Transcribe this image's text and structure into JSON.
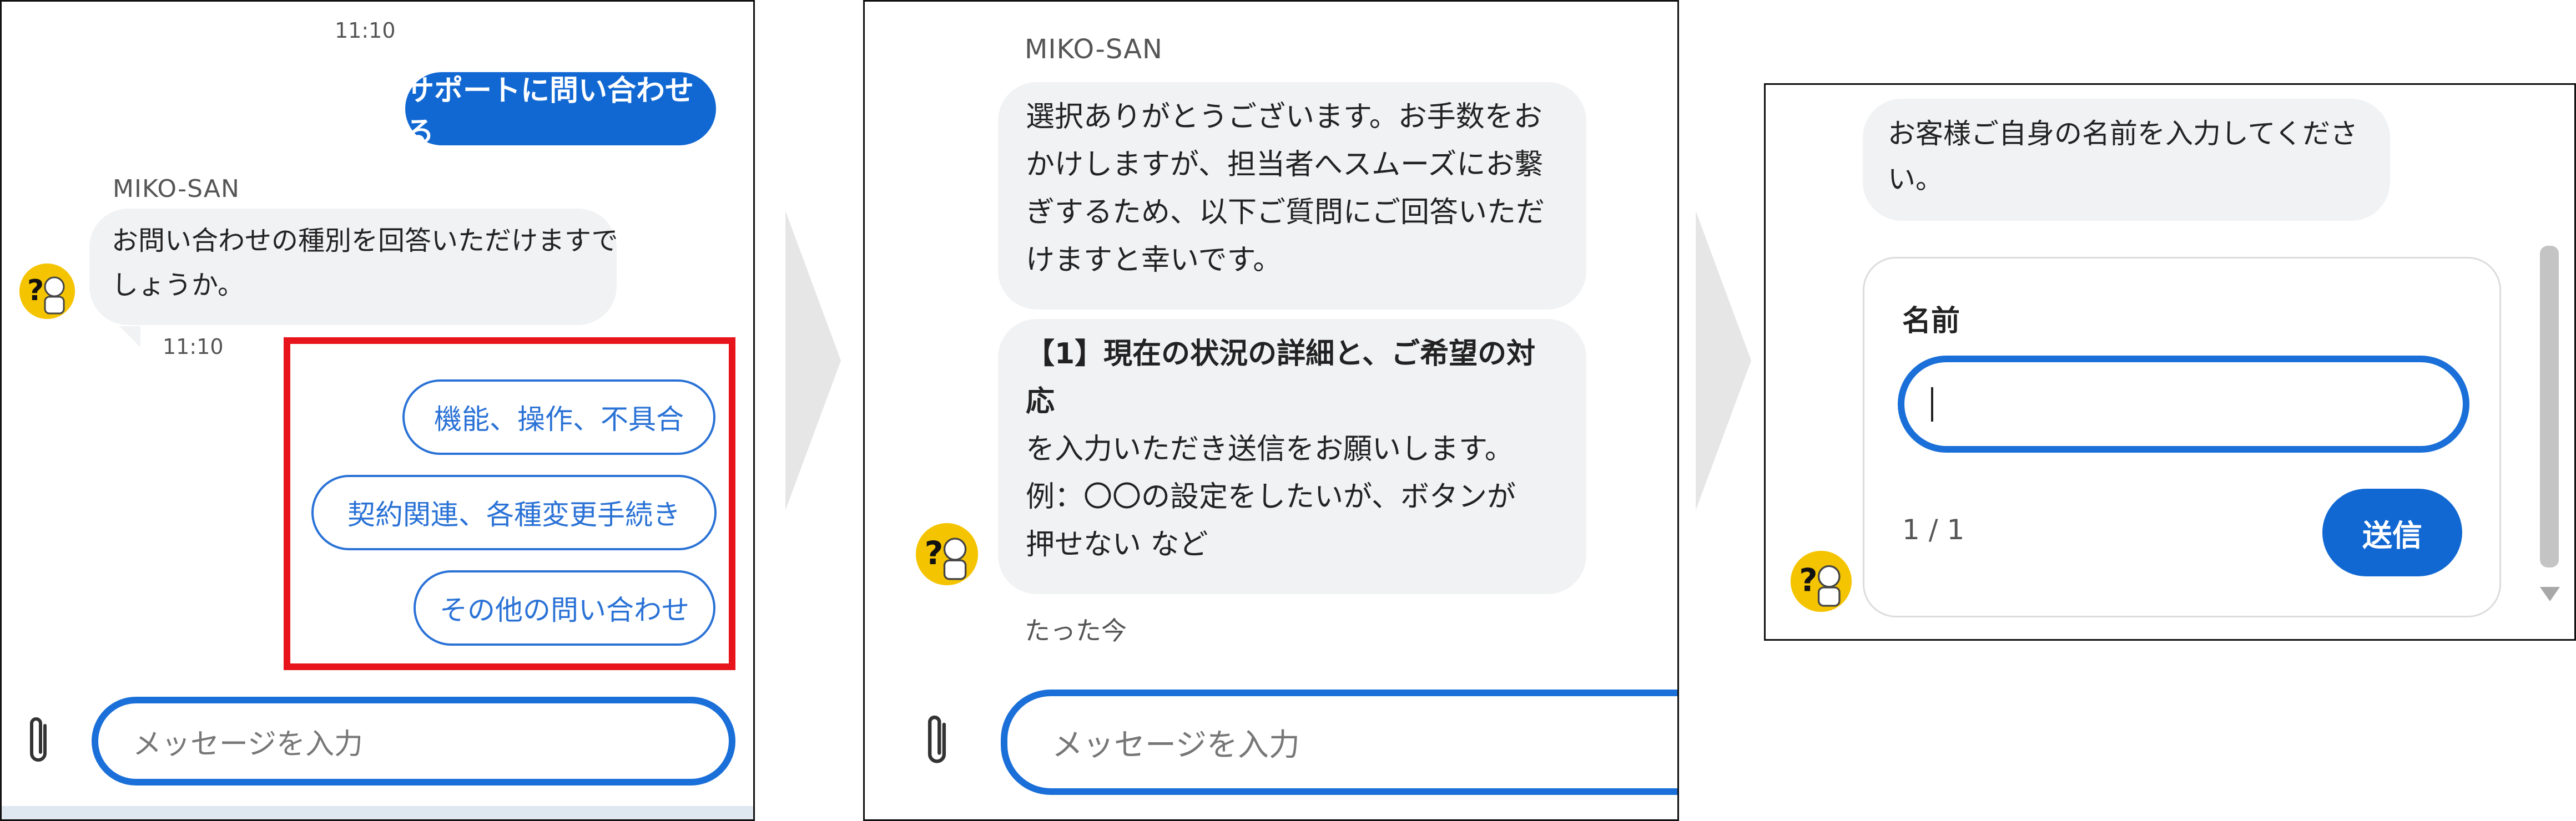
{
  "panel1": {
    "timestamp_top": "11:10",
    "user_message": "サポートに問い合わせる",
    "sender": "MIKO-SAN",
    "bot_lines": [
      "お問い合わせの種別を回答いただけますで",
      "しょうか。"
    ],
    "timestamp_bot": "11:10",
    "quick_replies": [
      "機能、操作、不具合",
      "契約関連、各種変更手続き",
      "その他の問い合わせ"
    ],
    "input_placeholder": "メッセージを入力",
    "highlight_color": "#e8141c"
  },
  "panel2": {
    "sender": "MIKO-SAN",
    "bubble1_lines": [
      "選択ありがとうございます。お手数をお",
      "かけしますが、担当者へスムーズにお繋",
      "ぎするため、以下ご質問にご回答いただ",
      "けますと幸いです。"
    ],
    "bubble2_bold_lines": [
      "【1】現在の状況の詳細と、ご希望の対",
      "応"
    ],
    "bubble2_lines": [
      "を入力いただき送信をお願いします。",
      "例：〇〇の設定をしたいが、ボタンが",
      "押せない など"
    ],
    "timestamp": "たった今",
    "input_placeholder": "メッセージを入力"
  },
  "panel3": {
    "bot_lines": [
      "お客様ご自身の名前を入力してくださ",
      "い。"
    ],
    "form_label": "名前",
    "counter": "1 / 1",
    "send_label": "送信"
  },
  "icons": {
    "attach": "paperclip-icon",
    "avatar": "bot-avatar-icon",
    "arrow": "chevron-right-shape"
  },
  "colors": {
    "accent": "#1168d2",
    "bubble_bg": "#f1f2f4"
  }
}
